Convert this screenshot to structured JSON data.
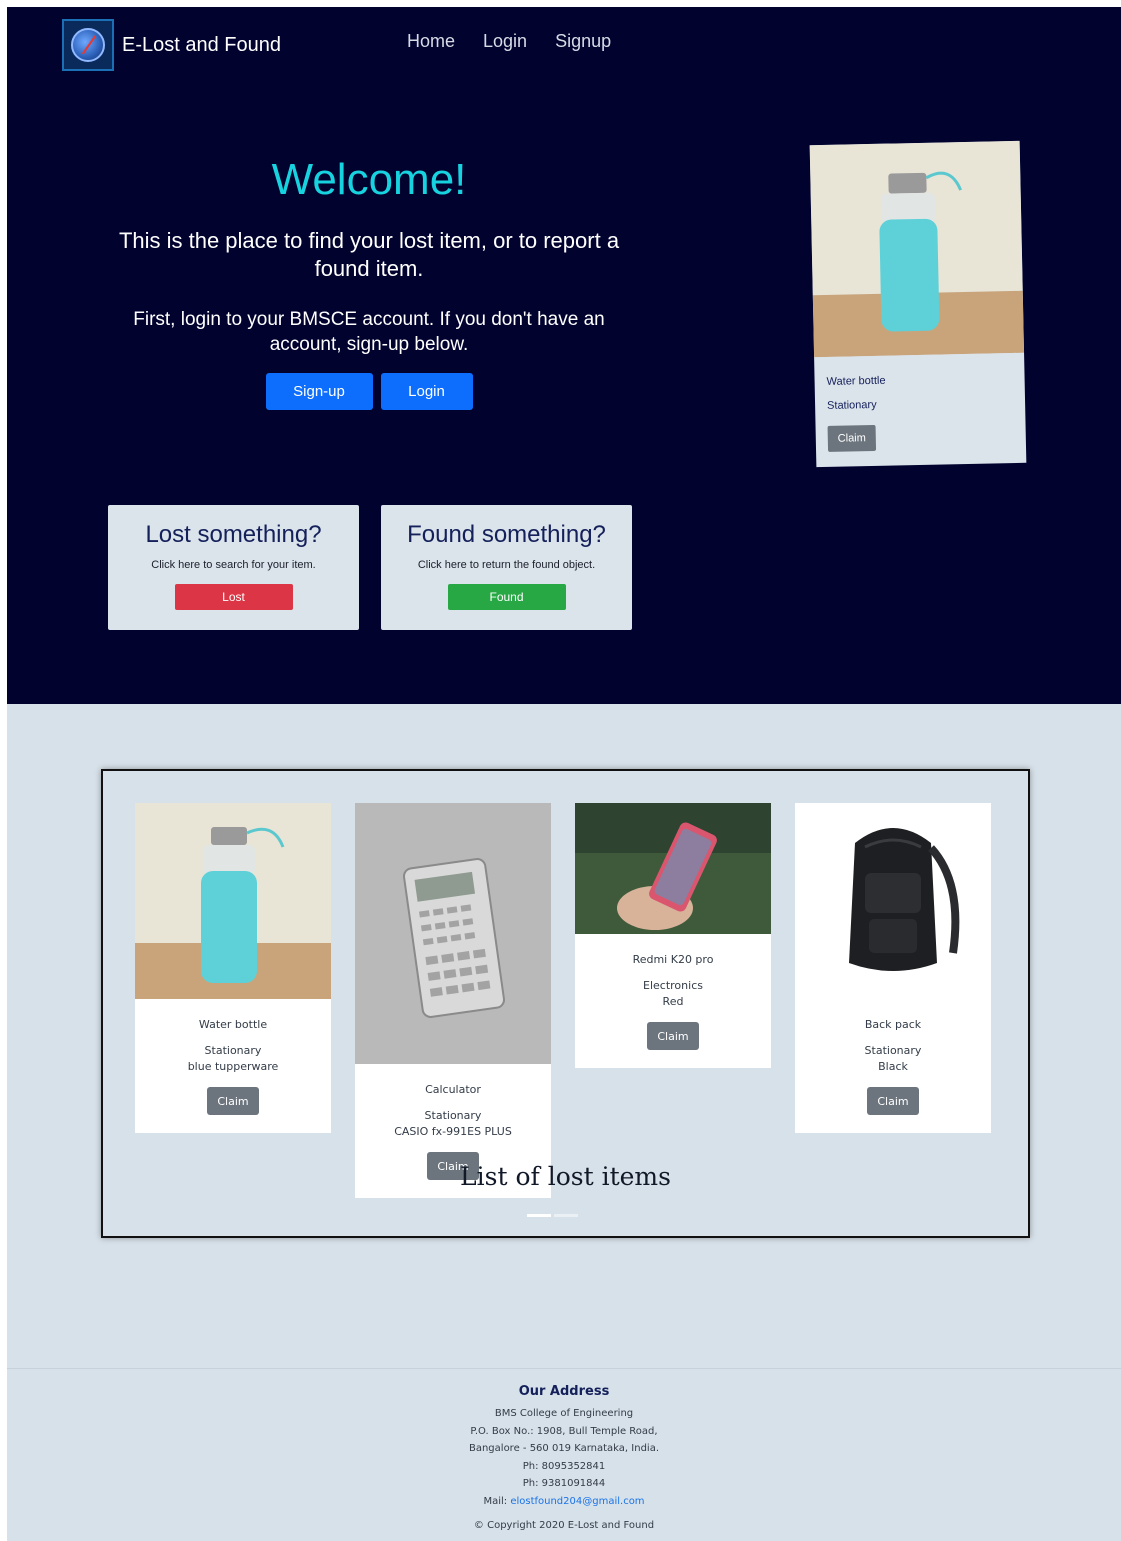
{
  "nav": {
    "brand": "E-Lost and Found",
    "links": [
      "Home",
      "Login",
      "Signup"
    ]
  },
  "hero": {
    "welcome": "Welcome!",
    "tagline": "This is the place to find your lost item, or to report a found item.",
    "instruction": "First, login to your BMSCE account. If you don't have an account, sign-up below.",
    "signup_button": "Sign-up",
    "login_button": "Login"
  },
  "lost_card": {
    "title": "Lost something?",
    "text": "Click here to search for your item.",
    "button": "Lost"
  },
  "found_card": {
    "title": "Found something?",
    "text": "Click here to return the found object.",
    "button": "Found"
  },
  "featured": {
    "name": "Water bottle",
    "category": "Stationary",
    "claim": "Claim"
  },
  "lost_items": {
    "caption": "List of lost items",
    "items": [
      {
        "name": "Water bottle",
        "category": "Stationary",
        "description": "blue tupperware",
        "claim": "Claim"
      },
      {
        "name": "Calculator",
        "category": "Stationary",
        "description": "CASIO fx-991ES PLUS",
        "claim": "Claim"
      },
      {
        "name": "Redmi K20 pro",
        "category": "Electronics",
        "description": "Red",
        "claim": "Claim"
      },
      {
        "name": "Back pack",
        "category": "Stationary",
        "description": "Black",
        "claim": "Claim"
      }
    ]
  },
  "footer": {
    "heading": "Our Address",
    "college": "BMS College of Engineering",
    "po_box": "P.O. Box No.: 1908, Bull Temple Road,",
    "city": "Bangalore - 560 019 Karnataka, India.",
    "phone1": "Ph: 8095352841",
    "phone2": "Ph: 9381091844",
    "mail_label": "Mail:",
    "email": "elostfound204@gmail.com",
    "copyright": "© Copyright 2020 E-Lost and Found"
  },
  "colors": {
    "hero_bg": "#01022e",
    "accent": "#17d3e0",
    "primary": "#0d6efd",
    "danger": "#dc3545",
    "success": "#28a745",
    "section_bg": "#d7e1e9"
  }
}
